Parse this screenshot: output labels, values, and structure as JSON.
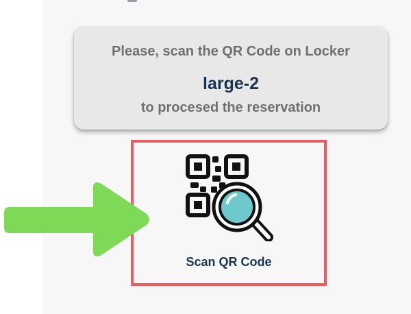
{
  "info_card": {
    "line1": "Please, scan the QR Code on Locker",
    "locker_name": "large-2",
    "line3": "to procesed the reservation"
  },
  "scan_button": {
    "label": "Scan QR Code",
    "icon": "qr-code-magnifier-icon"
  },
  "annotation": {
    "arrow_icon": "green-arrow-right-icon",
    "arrow_color": "#7ed957",
    "highlight_color": "#f05a5f"
  },
  "colors": {
    "text_dark": "#163552",
    "text_muted": "#6f6f72",
    "card_bg": "#e8e8e9",
    "page_bg": "#f7f7f8",
    "lens": "#6ec9cc"
  }
}
